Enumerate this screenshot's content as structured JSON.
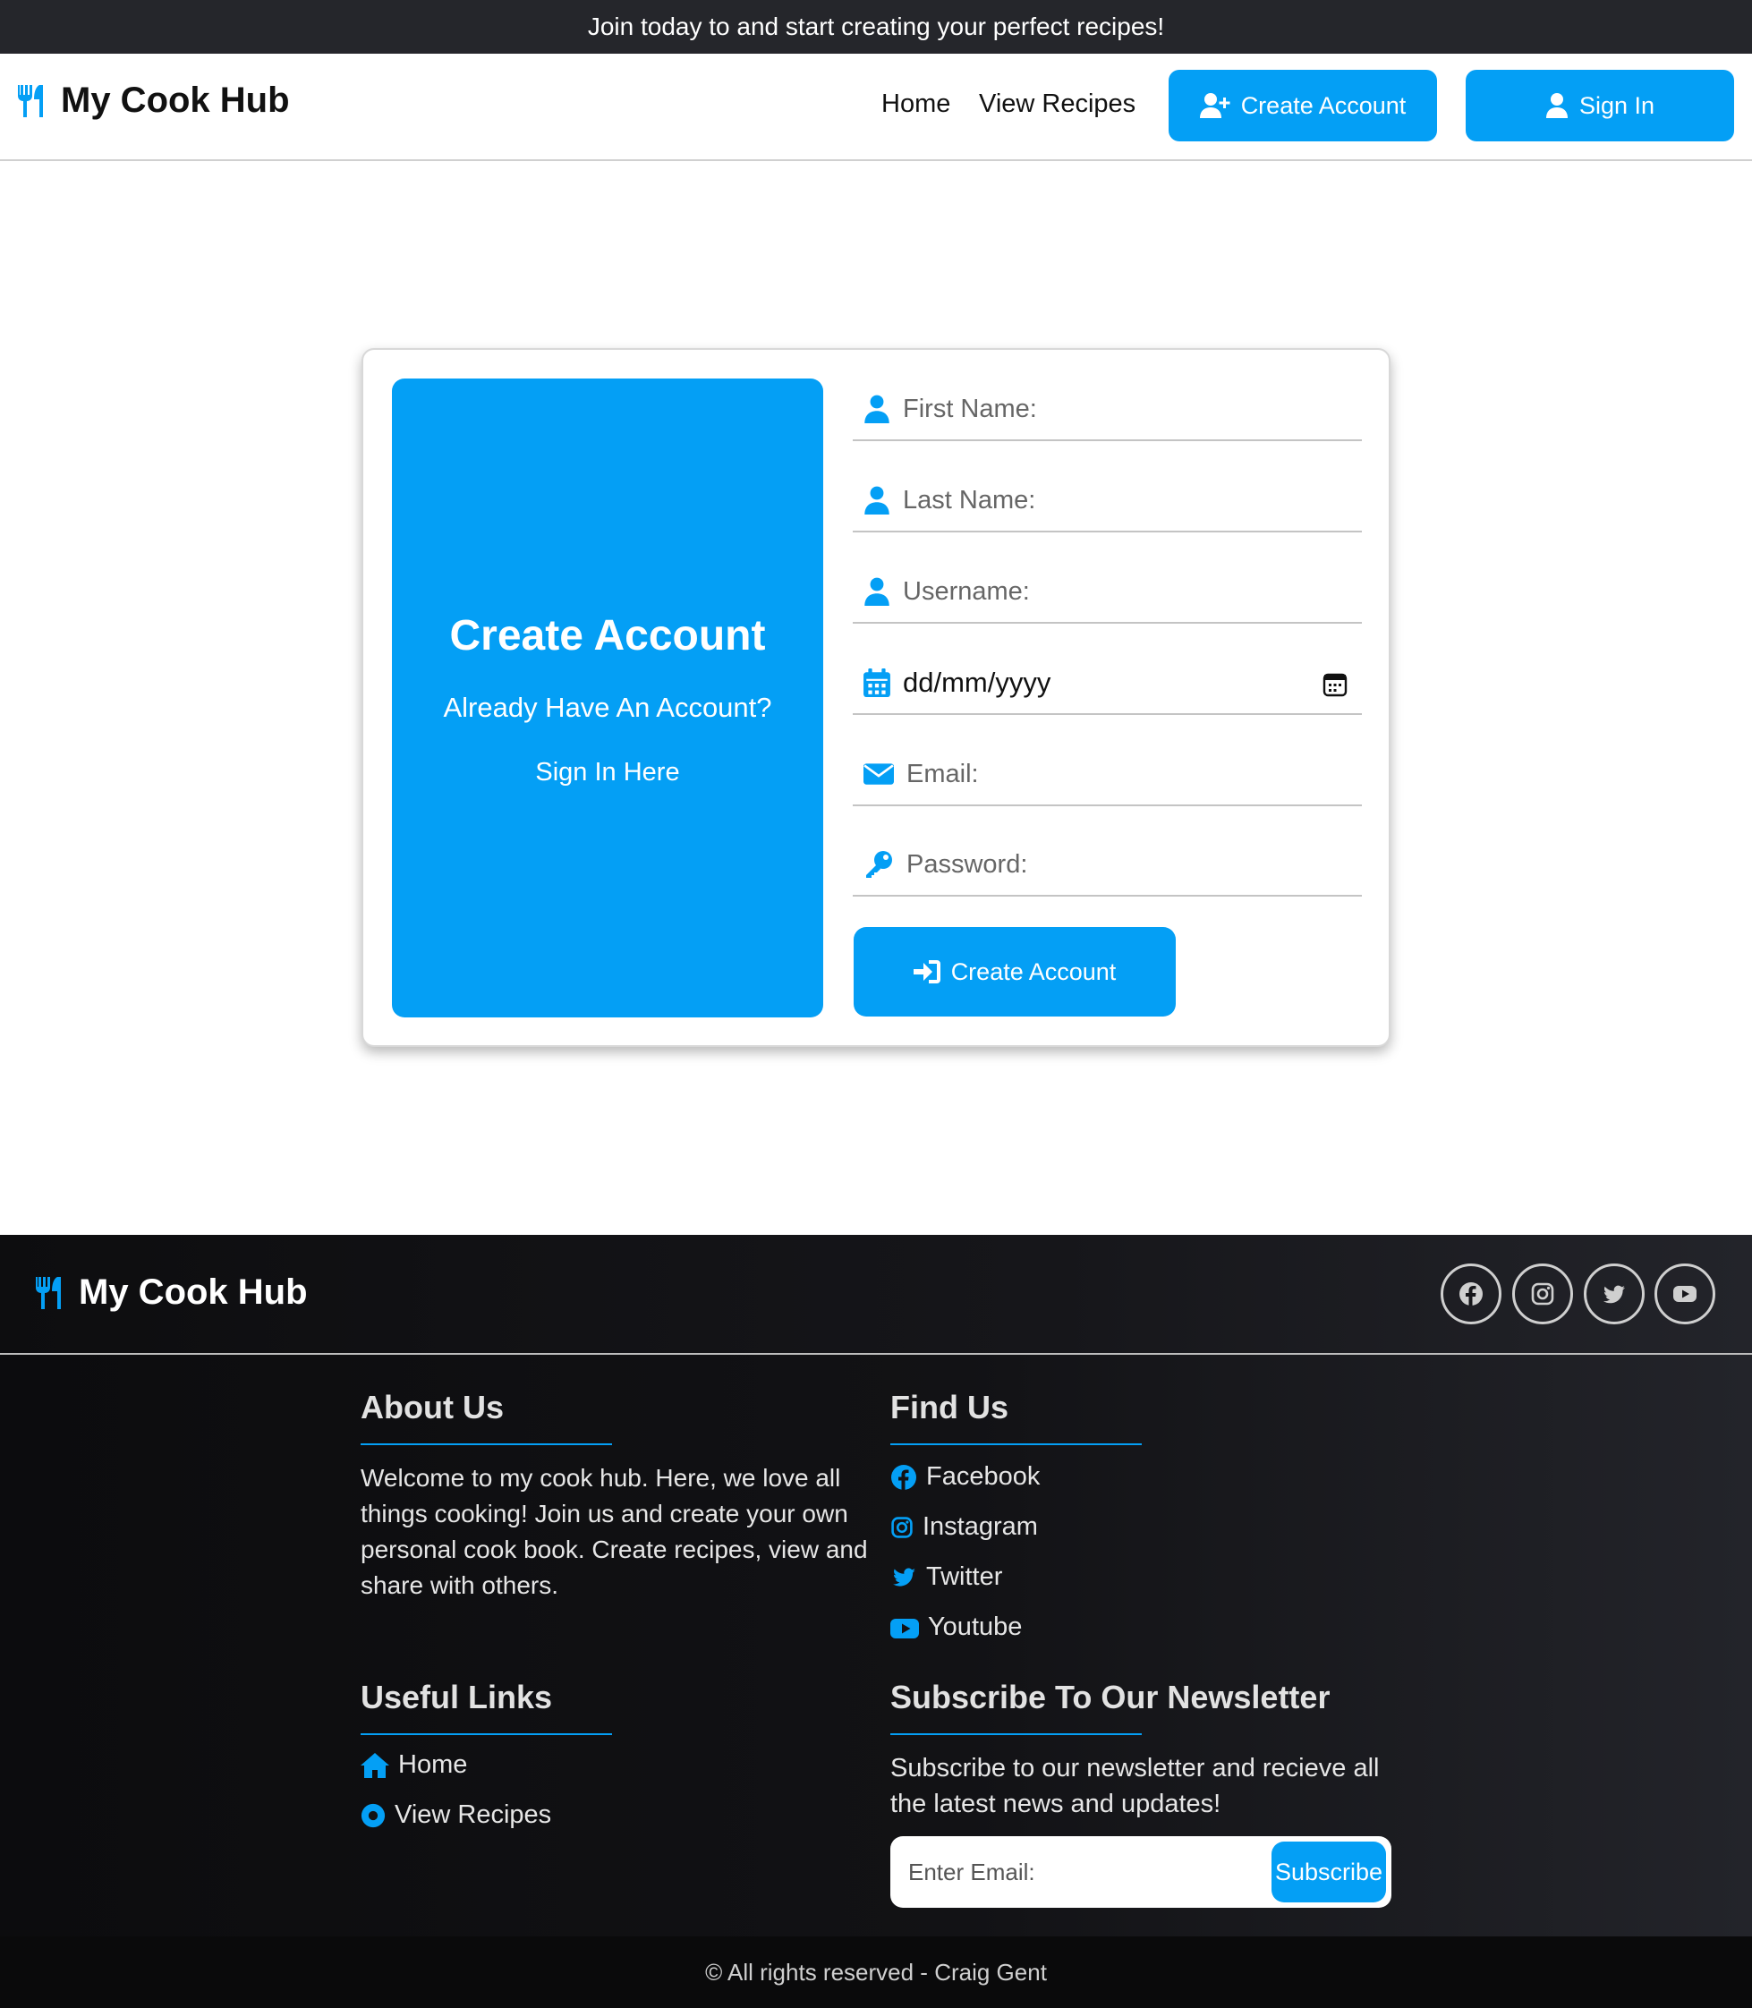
{
  "banner": {
    "text": "Join today to and start creating your perfect recipes!"
  },
  "nav": {
    "brand": "My Cook Hub",
    "links": {
      "home": "Home",
      "view_recipes": "View Recipes"
    },
    "create_account": "Create Account",
    "sign_in": "Sign In"
  },
  "panel": {
    "title": "Create Account",
    "subtitle": "Already Have An Account?",
    "signin_link": "Sign In Here"
  },
  "form": {
    "first_name_placeholder": "First Name:",
    "last_name_placeholder": "Last Name:",
    "username_placeholder": "Username:",
    "dob_value": "dd/mm/yyyy",
    "email_placeholder": "Email:",
    "password_placeholder": "Password:",
    "submit_label": "Create Account"
  },
  "footer": {
    "brand": "My Cook Hub",
    "social_icons": [
      "facebook-icon",
      "instagram-icon",
      "twitter-icon",
      "youtube-icon"
    ],
    "about": {
      "heading": "About Us",
      "text": "Welcome to my cook hub. Here, we love all things cooking! Join us and create your own personal cook book. Create recipes, view and share with others."
    },
    "find_us": {
      "heading": "Find Us",
      "links": [
        "Facebook",
        "Instagram",
        "Twitter",
        "Youtube"
      ]
    },
    "useful_links": {
      "heading": "Useful Links",
      "links": [
        "Home",
        "View Recipes"
      ]
    },
    "newsletter": {
      "heading": "Subscribe To Our Newsletter",
      "text": "Subscribe to our newsletter and recieve all the latest news and updates!",
      "email_placeholder": "Enter Email:",
      "button": "Subscribe"
    },
    "copyright": "© All rights reserved - Craig Gent"
  },
  "colors": {
    "accent": "#049ff5",
    "dark": "#25262b"
  }
}
